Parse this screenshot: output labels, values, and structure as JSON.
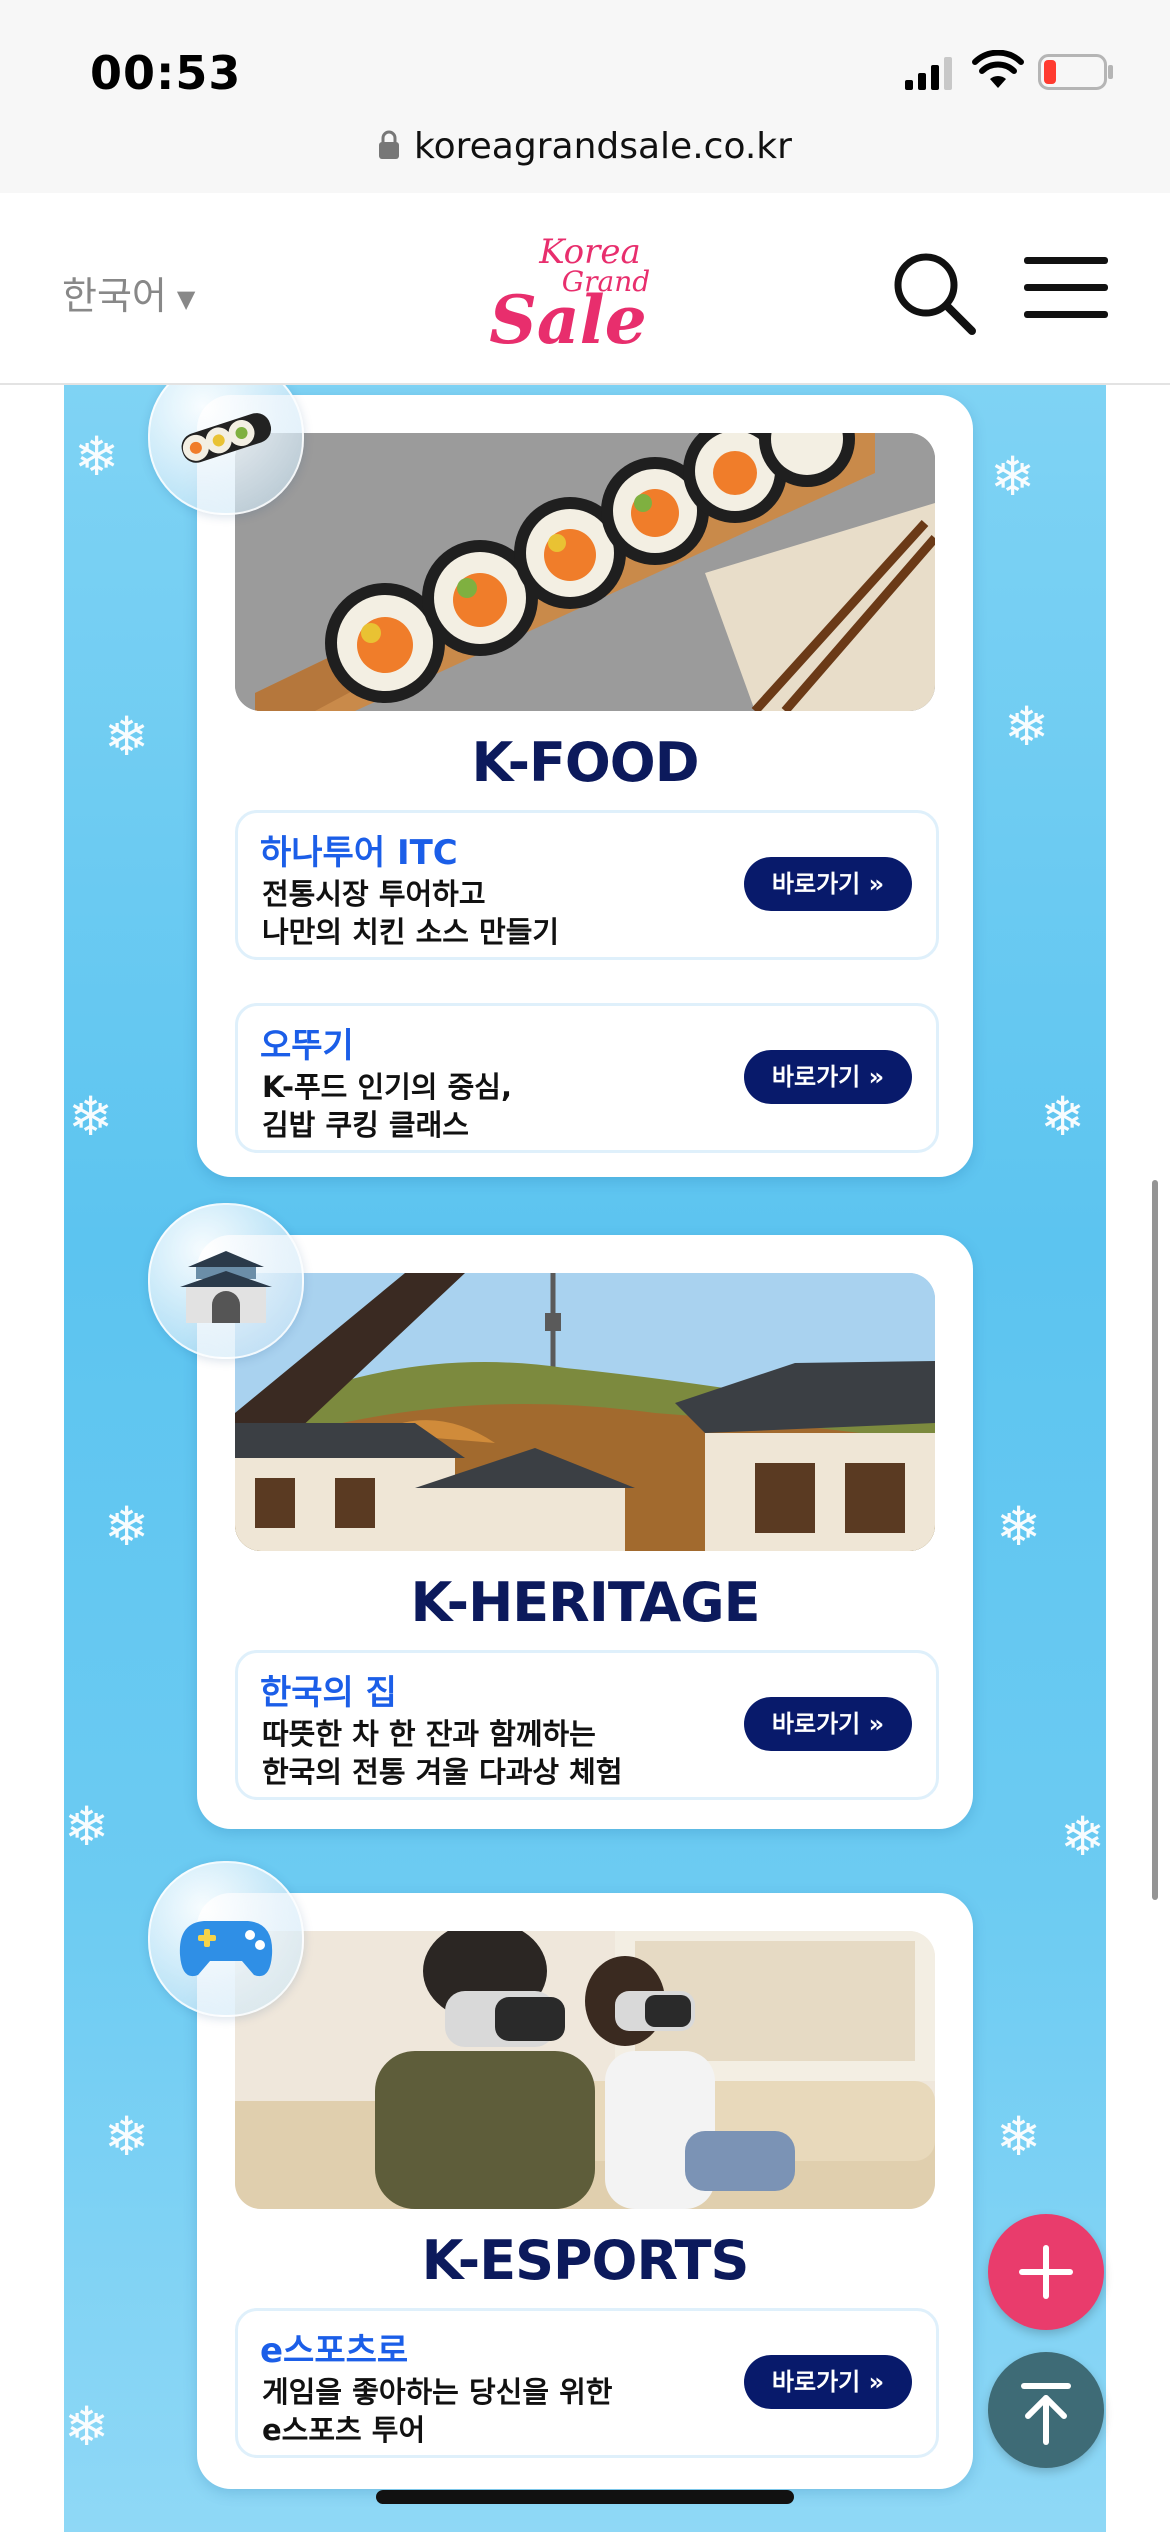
{
  "status_bar": {
    "time": "00:53",
    "battery_color": "#ff3b30"
  },
  "browser": {
    "url": "koreagrandsale.co.kr"
  },
  "header": {
    "language": "한국어",
    "logo_line1": "Korea",
    "logo_line2": "Grand",
    "logo_line3": "Sale",
    "logo_color": "#e82e6d"
  },
  "categories": [
    {
      "title": "K-FOOD",
      "icon": "gimbap-icon",
      "items": [
        {
          "brand": "하나투어 ITC",
          "line1": "전통시장 투어하고",
          "line2": "나만의 치킨 소스 만들기",
          "button": "바로가기 »"
        },
        {
          "brand": "오뚜기",
          "line1": "K-푸드 인기의 중심,",
          "line2": "김밥 쿠킹 클래스",
          "button": "바로가기 »"
        }
      ]
    },
    {
      "title": "K-HERITAGE",
      "icon": "palace-gate-icon",
      "items": [
        {
          "brand": "한국의 집",
          "line1": "따뜻한 차 한 잔과 함께하는",
          "line2": "한국의 전통 겨울 다과상 체험",
          "button": "바로가기 »"
        }
      ]
    },
    {
      "title": "K-ESPORTS",
      "icon": "game-controller-icon",
      "items": [
        {
          "brand": "e스포츠로",
          "line1": "게임을 좋아하는 당신을 위한",
          "line2": "e스포츠 투어",
          "button": "바로가기 »"
        }
      ]
    }
  ],
  "colors": {
    "accent_blue": "#1b5ee8",
    "navy": "#0c1a5c",
    "button_bg": "#081a6b",
    "fab_plus": "#e93c6c",
    "fab_top": "#3e6b76"
  }
}
